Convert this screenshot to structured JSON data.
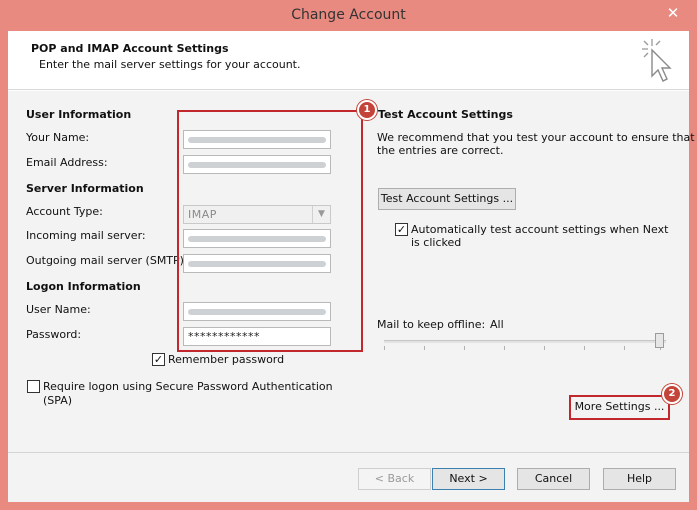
{
  "window": {
    "title": "Change Account",
    "close_glyph": "✕"
  },
  "header": {
    "title": "POP and IMAP Account Settings",
    "subtitle": "Enter the mail server settings for your account.",
    "icon": "mouse-cursor-click-icon"
  },
  "user_information": {
    "heading": "User Information",
    "your_name_label": "Your Name:",
    "email_label": "Email Address:"
  },
  "server_information": {
    "heading": "Server Information",
    "account_type_label": "Account Type:",
    "account_type_value": "IMAP",
    "incoming_label": "Incoming mail server:",
    "outgoing_label": "Outgoing mail server (SMTP):"
  },
  "logon_information": {
    "heading": "Logon Information",
    "user_name_label": "User Name:",
    "password_label": "Password:",
    "password_value": "************",
    "remember_password_label": "Remember password",
    "remember_password_checked": true,
    "spa_label_line1": "Require logon using Secure Password Authentication",
    "spa_label_line2": "(SPA)",
    "spa_checked": false
  },
  "test_settings": {
    "heading": "Test Account Settings",
    "description_line1": "We recommend that you test your account to ensure that",
    "description_line2": "the entries are correct.",
    "test_button": "Test Account Settings ...",
    "auto_test_label_line1": "Automatically test account settings when Next",
    "auto_test_label_line2": "is clicked",
    "auto_test_checked": true
  },
  "offline": {
    "label": "Mail to keep offline:",
    "value": "All"
  },
  "more_settings_button": "More Settings ...",
  "annotations": {
    "badge1": "1",
    "badge2": "2",
    "accent_color": "#c0282d"
  },
  "footer": {
    "back": "< Back",
    "next": "Next >",
    "cancel": "Cancel",
    "help": "Help"
  }
}
